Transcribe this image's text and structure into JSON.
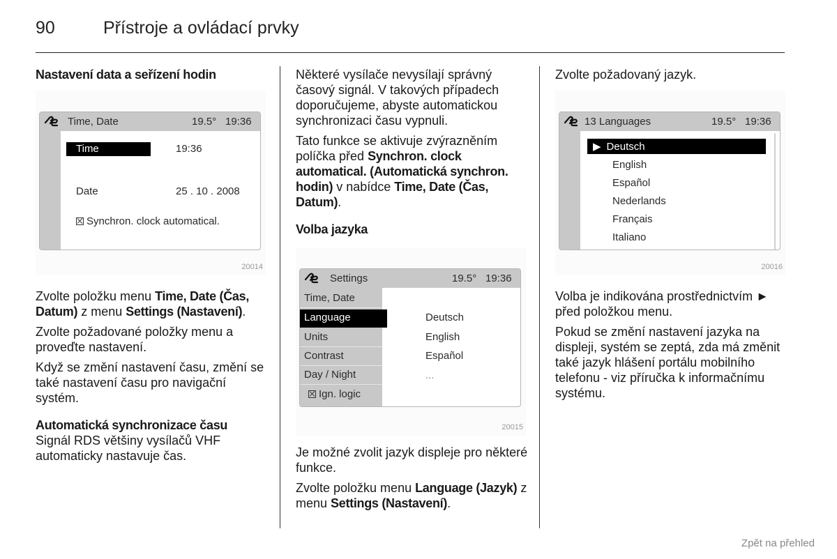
{
  "page": {
    "number": "90",
    "title": "Přístroje a ovládací prvky",
    "footer_link": "Zpět na přehled"
  },
  "col1": {
    "heading": "Nastavení data a seřízení hodin",
    "figure": {
      "id": "20014",
      "icon": "settings-wrench-icon",
      "title": "Time, Date",
      "temp": "19.5°",
      "clock": "19:36",
      "rows": [
        {
          "label": "Time",
          "value": "19:36",
          "selected": true
        },
        {
          "label": "Date",
          "value": "25 . 10 . 2008",
          "selected": false
        }
      ],
      "checkbox_label": "Synchron. clock automatical.",
      "checkbox_checked": true
    },
    "p1": {
      "t1": "Zvolte položku menu ",
      "b1": "Time, Date (Čas, Datum)",
      "t2": " z menu ",
      "b2": "Settings (Nastavení)",
      "t3": "."
    },
    "p2": "Zvolte požadované položky menu a proveďte nastavení.",
    "p3": "Když se změní nastavení času, změní se také nastavení času pro navigační systém.",
    "subheading": "Automatická synchronizace času",
    "p4": "Signál RDS většiny vysílačů VHF automaticky nastavuje čas."
  },
  "col2": {
    "p1": "Některé vysílače nevysílají správný časový signál. V takových případech doporučujeme, abyste automatickou synchronizaci času vypnuli.",
    "p2": {
      "t1": "Tato funkce se aktivuje zvýrazněním políčka před ",
      "b1": "Synchron. clock automatical. (Automatická synchron. hodin)",
      "t2": " v nabídce ",
      "b2": "Time, Date (Čas, Datum)",
      "t3": "."
    },
    "heading": "Volba jazyka",
    "figure": {
      "id": "20015",
      "icon": "settings-wrench-icon",
      "title": "Settings",
      "temp": "19.5°",
      "clock": "19:36",
      "menu": [
        "Time, Date",
        "Language",
        "Units",
        "Contrast",
        "Day / Night"
      ],
      "menu_selected": "Language",
      "ign_logic_label": "Ign. logic",
      "ign_logic_checked": true,
      "languages": [
        "Deutsch",
        "English",
        "Español",
        "..."
      ]
    },
    "p3": "Je možné zvolit jazyk displeje pro některé funkce.",
    "p4": {
      "t1": "Zvolte položku menu ",
      "b1": "Language (Jazyk)",
      "t2": " z menu ",
      "b2": "Settings (Nastavení)",
      "t3": "."
    }
  },
  "col3": {
    "p1": "Zvolte požadovaný jazyk.",
    "figure": {
      "id": "20016",
      "icon": "settings-wrench-icon",
      "title": "13 Languages",
      "temp": "19.5°",
      "clock": "19:36",
      "selected_marker": "▶",
      "languages": [
        "Deutsch",
        "English",
        "Español",
        "Nederlands",
        "Français",
        "Italiano"
      ],
      "selected": "Deutsch"
    },
    "p2": {
      "marker": "►",
      "t1": "Volba je indikována prostřednictvím ",
      "t2": " před položkou menu."
    },
    "p3": "Pokud se změní nastavení jazyka na displeji, systém se zeptá, zda má změnit také jazyk hlášení portálu mobilního telefonu - viz příručka k informačnímu systému."
  }
}
